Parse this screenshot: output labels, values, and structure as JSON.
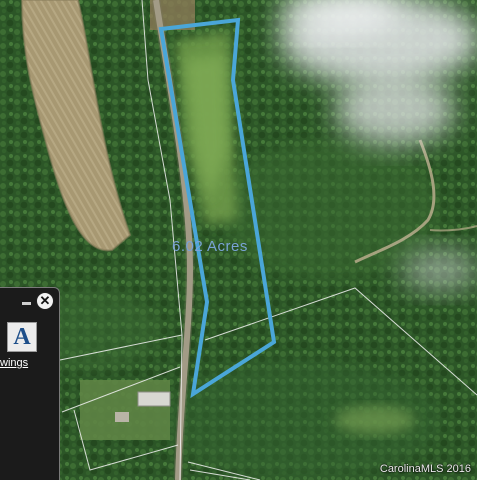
{
  "map": {
    "acreage_label": "6.02 Acres",
    "credit": "CarolinaMLS 2016",
    "parcel_outline_color": "#4aa6d8",
    "lot_line_color": "#f2f2f2"
  },
  "widget": {
    "minimize_glyph": "",
    "close_glyph": "✕",
    "text_tool_glyph": "A",
    "link_label": "wings"
  }
}
